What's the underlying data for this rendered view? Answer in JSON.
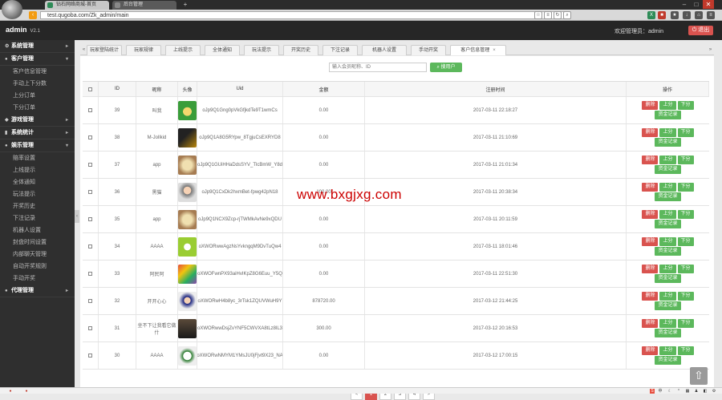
{
  "browser": {
    "tabs": [
      {
        "label": "钻石网络商城-首页"
      },
      {
        "label": "后台管理"
      }
    ],
    "new_tab": "+",
    "url": "test.qugoba.com/Zk_admin/main"
  },
  "app": {
    "brand": "admin",
    "version": "V2.1",
    "welcome": "欢迎管理员：admin",
    "logout": "退出"
  },
  "sidebar": {
    "sections": [
      {
        "label": "系统管理",
        "items": []
      },
      {
        "label": "客户管理",
        "items": [
          "客户信息管理",
          "手动上下分数",
          "上分订单",
          "下分订单"
        ]
      },
      {
        "label": "游戏管理",
        "items": []
      },
      {
        "label": "系统统计",
        "items": []
      },
      {
        "label": "娱乐管理",
        "items": [
          "赔率设置",
          "上线提示",
          "全体通知",
          "玩法提示",
          "开奖历史",
          "下注记录",
          "机器人设置",
          "封盘时间设置",
          "内部聊天管理",
          "自动开奖规则",
          "手动开奖"
        ]
      },
      {
        "label": "代理管理",
        "items": []
      }
    ]
  },
  "content_tabs": [
    "玩家登陆统计",
    "玩家规律",
    "上线提示",
    "全体通知",
    "玩法提示",
    "开奖历史",
    "下注记录",
    "机器人设置",
    "手动开奖",
    "客户信息管理"
  ],
  "search": {
    "placeholder": "输入会员昵称、ID",
    "button": "搜用户"
  },
  "table": {
    "headers": [
      "ID",
      "昵称",
      "头像",
      "Uid",
      "金额",
      "注册时间",
      "操作"
    ],
    "rows": [
      {
        "id": "39",
        "nick": "叫我",
        "uid": "oJp9Q1Gng0pVkGfjkdTe9T1wmCs",
        "amount": "0.00",
        "time": "2017-03-11 22:18:27",
        "avatar": "green"
      },
      {
        "id": "38",
        "nick": "M-Jollkid",
        "uid": "oJp9Q1A8G5RYpw_8TgjuCsEXRYD8",
        "amount": "0.00",
        "time": "2017-03-11 21:10:69",
        "avatar": "dark"
      },
      {
        "id": "37",
        "nick": "app",
        "uid": "oJp9Q1GUiHHaDdsSYV_TlcBmW_Y8d",
        "amount": "0.00",
        "time": "2017-03-11 21:01:34",
        "avatar": "cat"
      },
      {
        "id": "36",
        "nick": "黑猫",
        "uid": "oJp9Q1CxDk2hxmBet-fpwg42pN18",
        "amount": "100.00",
        "time": "2017-03-11 20:38:34",
        "avatar": "man"
      },
      {
        "id": "35",
        "nick": "app",
        "uid": "oJp9Q1NCX9Zcp-rjTWMkAvNe9xQDU",
        "amount": "0.00",
        "time": "2017-03-11 20:11:59",
        "avatar": "cat"
      },
      {
        "id": "34",
        "nick": "AAAA",
        "uid": "oXWORwwAgzNsYvkngqM9DvTuQw4",
        "amount": "0.00",
        "time": "2017-03-11 18:01:46",
        "avatar": "lime"
      },
      {
        "id": "33",
        "nick": "阿民阿",
        "uid": "oXWOFwnPX93aiHvIKpZ8G6Euu_Y5Q",
        "amount": "0.00",
        "time": "2017-03-11 22:51:30",
        "avatar": "colorful"
      },
      {
        "id": "32",
        "nick": "开开心心",
        "uid": "oXWORwH4b8yc_3rTsk1ZQUVWuH9Y",
        "amount": "878720.00",
        "time": "2017-03-12 21:44:25",
        "avatar": "grad"
      },
      {
        "id": "31",
        "nick": "坐不下让我看它做什",
        "uid": "oXWORwwDsjZvYNF5CWVXA8tLz8lL3",
        "amount": "300.00",
        "time": "2017-03-12 20:16:53",
        "avatar": "person"
      },
      {
        "id": "30",
        "nick": "AAAA",
        "uid": "oXWORwNMYM1YMsJU0jFjvt9X23_NA",
        "amount": "0.00",
        "time": "2017-03-12 17:00:15",
        "avatar": "cartoon"
      }
    ],
    "actions": {
      "delete": "删除",
      "up": "上分",
      "down": "下分",
      "record": "资金记录"
    }
  },
  "pagination": [
    "<",
    "1",
    "2",
    "3",
    "4",
    ">"
  ],
  "watermark": "www.bxgjxg.com",
  "colors": {
    "accent_red": "#d9534f",
    "accent_green": "#5cb85c",
    "sidebar_bg": "#2f2f2f"
  }
}
